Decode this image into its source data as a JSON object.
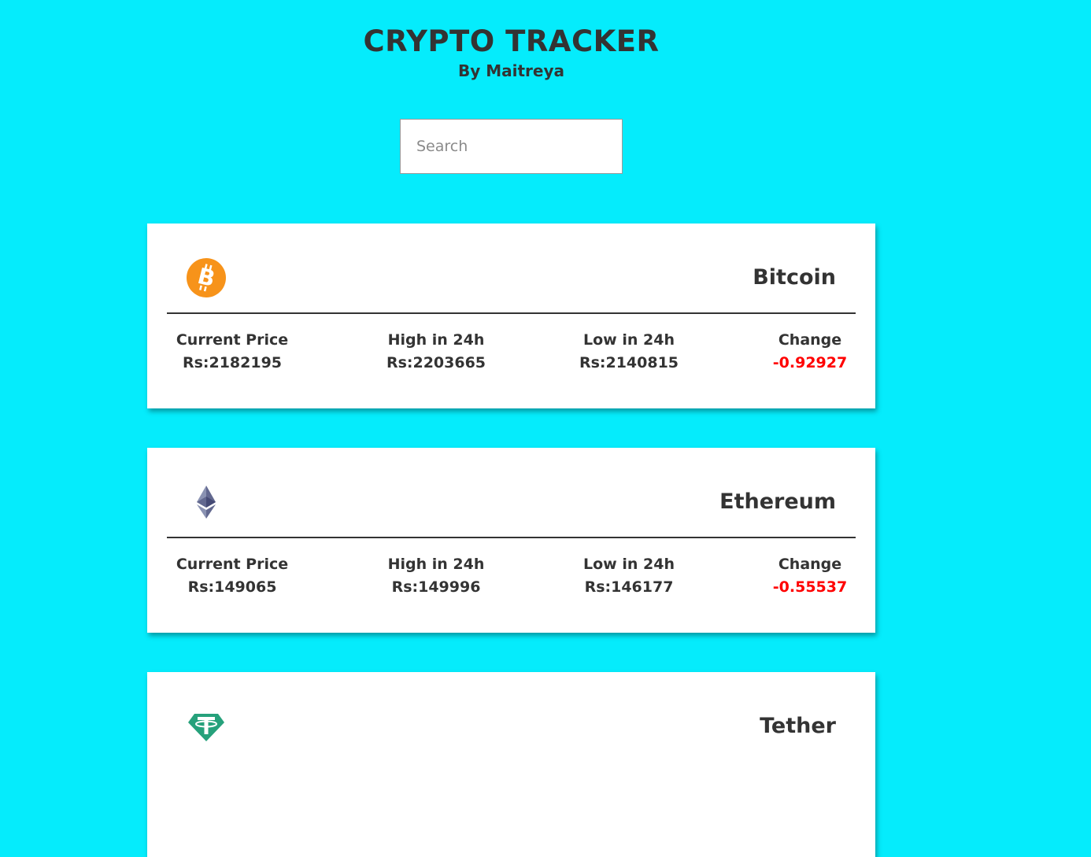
{
  "header": {
    "title": "CRYPTO TRACKER",
    "subtitle": "By Maitreya"
  },
  "search": {
    "placeholder": "Search",
    "value": ""
  },
  "colors": {
    "background": "#05ecfc",
    "negative_change": "#ff0000",
    "bitcoin_orange": "#f7931a",
    "ethereum_purple": "#627eea",
    "tether_teal": "#26a17b"
  },
  "coins": [
    {
      "name": "Bitcoin",
      "icon": "bitcoin-logo-icon",
      "current_price_label": "Current Price",
      "current_price": "Rs:2182195",
      "high_label": "High in 24h",
      "high": "Rs:2203665",
      "low_label": "Low in 24h",
      "low": "Rs:2140815",
      "change_label": "Change",
      "change": "-0.92927"
    },
    {
      "name": "Ethereum",
      "icon": "ethereum-logo-icon",
      "current_price_label": "Current Price",
      "current_price": "Rs:149065",
      "high_label": "High in 24h",
      "high": "Rs:149996",
      "low_label": "Low in 24h",
      "low": "Rs:146177",
      "change_label": "Change",
      "change": "-0.55537"
    },
    {
      "name": "Tether",
      "icon": "tether-logo-icon"
    }
  ]
}
